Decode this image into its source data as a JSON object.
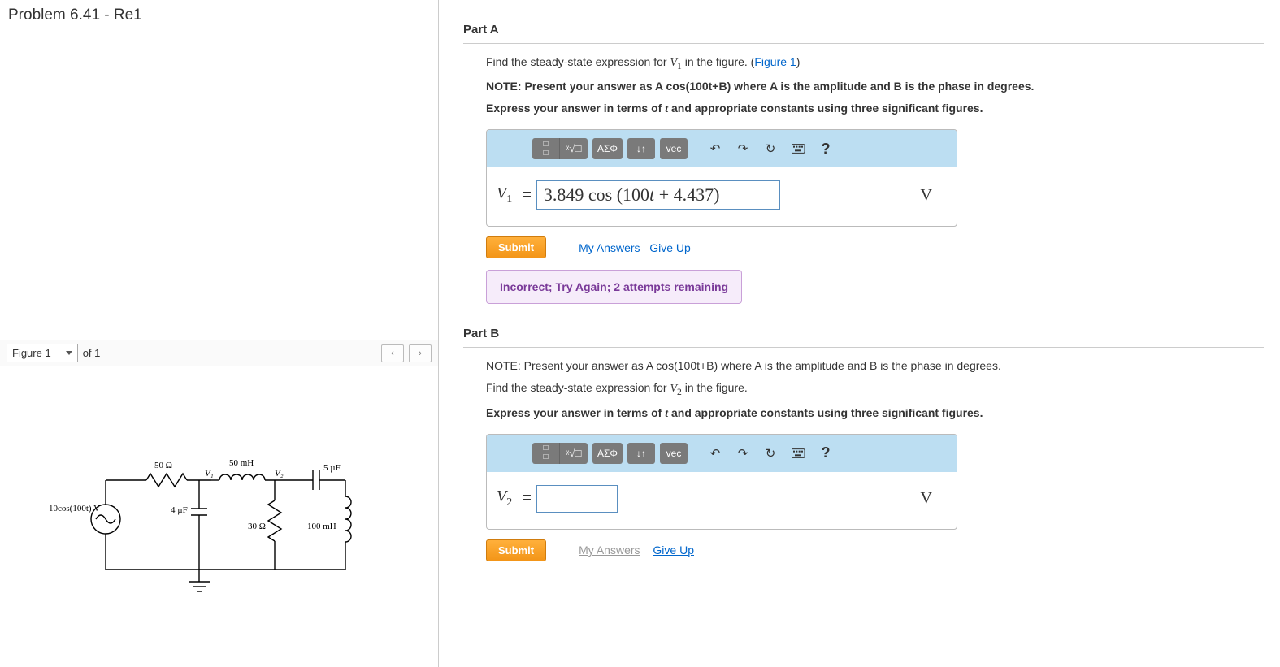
{
  "problem_title": "Problem 6.41 - Re1",
  "figure_bar": {
    "selected": "Figure 1",
    "of_text": "of 1",
    "prev": "‹",
    "next": "›"
  },
  "circuit": {
    "source": "10cos(100t) V",
    "r1": "50 Ω",
    "v1_label": "V₁",
    "l1": "50 mH",
    "v2_label": "V₂",
    "c1": "5 µF",
    "c2": "4 µF",
    "r2": "30 Ω",
    "l2": "100 mH"
  },
  "part_a": {
    "header": "Part A",
    "prompt_pre": "Find the steady-state expression for ",
    "prompt_var": "V",
    "prompt_sub": "1",
    "prompt_post": " in the figure. (",
    "figure_link": "Figure 1",
    "prompt_close": ")",
    "note": "NOTE: Present your answer as A cos(100t+B) where A is the amplitude and B is the phase in degrees.",
    "express": "Express your answer in terms of t and appropriate constants using three significant figures.",
    "label_var": "V",
    "label_sub": "1",
    "equals": "=",
    "value": "3.849 cos (100t + 4.437)",
    "unit": "V",
    "submit": "Submit",
    "my_answers": "My Answers",
    "give_up": "Give Up",
    "feedback": "Incorrect; Try Again; 2 attempts remaining"
  },
  "part_b": {
    "header": "Part B",
    "note": "NOTE: Present your answer as A cos(100t+B) where A is the amplitude and B is the phase in degrees.",
    "prompt_pre": "Find the steady-state expression for ",
    "prompt_var": "V",
    "prompt_sub": "2",
    "prompt_post": " in the figure.",
    "express": "Express your answer in terms of t and appropriate constants using three significant figures.",
    "label_var": "V",
    "label_sub": "2",
    "equals": "=",
    "value": "",
    "unit": "V",
    "submit": "Submit",
    "my_answers": "My Answers",
    "give_up": "Give Up"
  },
  "toolbar": {
    "template": "template",
    "sqrt": "x√",
    "greek": "ΑΣΦ",
    "subsup": "↓↑",
    "vec": "vec",
    "undo": "↶",
    "redo": "↷",
    "reset": "↻",
    "keyboard": "kb",
    "help": "?"
  }
}
